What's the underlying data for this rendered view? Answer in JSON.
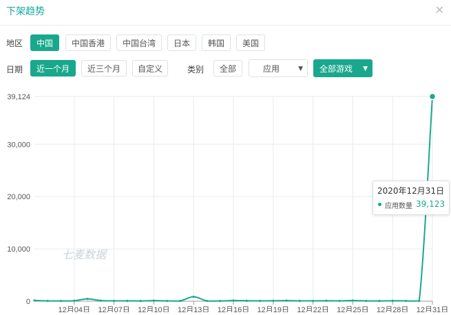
{
  "header": {
    "title": "下架趋势",
    "close_icon": "close-icon"
  },
  "region": {
    "label": "地区",
    "options": [
      "中国",
      "中国香港",
      "中国台湾",
      "日本",
      "韩国",
      "美国"
    ],
    "selected": "中国"
  },
  "date": {
    "label": "日期",
    "options": [
      "近一个月",
      "近三个月",
      "自定义"
    ],
    "selected": "近一个月"
  },
  "category": {
    "label": "类别",
    "all_label": "全部",
    "app_select": "应用",
    "game_select": "全部游戏"
  },
  "colors": {
    "accent": "#19a88c",
    "line": "#19a88c",
    "grid": "#e6ebee"
  },
  "watermark": "七麦数据",
  "tooltip": {
    "date": "2020年12月31日",
    "series_name": "应用数量",
    "value": "39,123"
  },
  "chart_data": {
    "type": "line",
    "title": "",
    "xlabel": "",
    "ylabel": "",
    "ylim": [
      0,
      39124
    ],
    "y_ticks": [
      "0",
      "10,000",
      "20,000",
      "30,000",
      "39,124"
    ],
    "y_tick_values": [
      0,
      10000,
      20000,
      30000,
      39124
    ],
    "x_tick_labels": [
      "12月04日",
      "12月07日",
      "12月10日",
      "12月13日",
      "12月16日",
      "12月19日",
      "12月22日",
      "12月25日",
      "12月28日",
      "12月31日"
    ],
    "grid": true,
    "series": [
      {
        "name": "应用数量",
        "x": [
          "12月01日",
          "12月02日",
          "12月03日",
          "12月04日",
          "12月05日",
          "12月06日",
          "12月07日",
          "12月08日",
          "12月09日",
          "12月10日",
          "12月11日",
          "12月12日",
          "12月13日",
          "12月14日",
          "12月15日",
          "12月16日",
          "12月17日",
          "12月18日",
          "12月19日",
          "12月20日",
          "12月21日",
          "12月22日",
          "12月23日",
          "12月24日",
          "12月25日",
          "12月26日",
          "12月27日",
          "12月28日",
          "12月29日",
          "12月30日",
          "12月31日"
        ],
        "values": [
          150,
          60,
          50,
          90,
          450,
          120,
          60,
          70,
          50,
          120,
          60,
          70,
          850,
          60,
          50,
          130,
          90,
          60,
          90,
          120,
          70,
          60,
          90,
          60,
          130,
          60,
          50,
          90,
          60,
          60,
          39123
        ]
      }
    ]
  }
}
